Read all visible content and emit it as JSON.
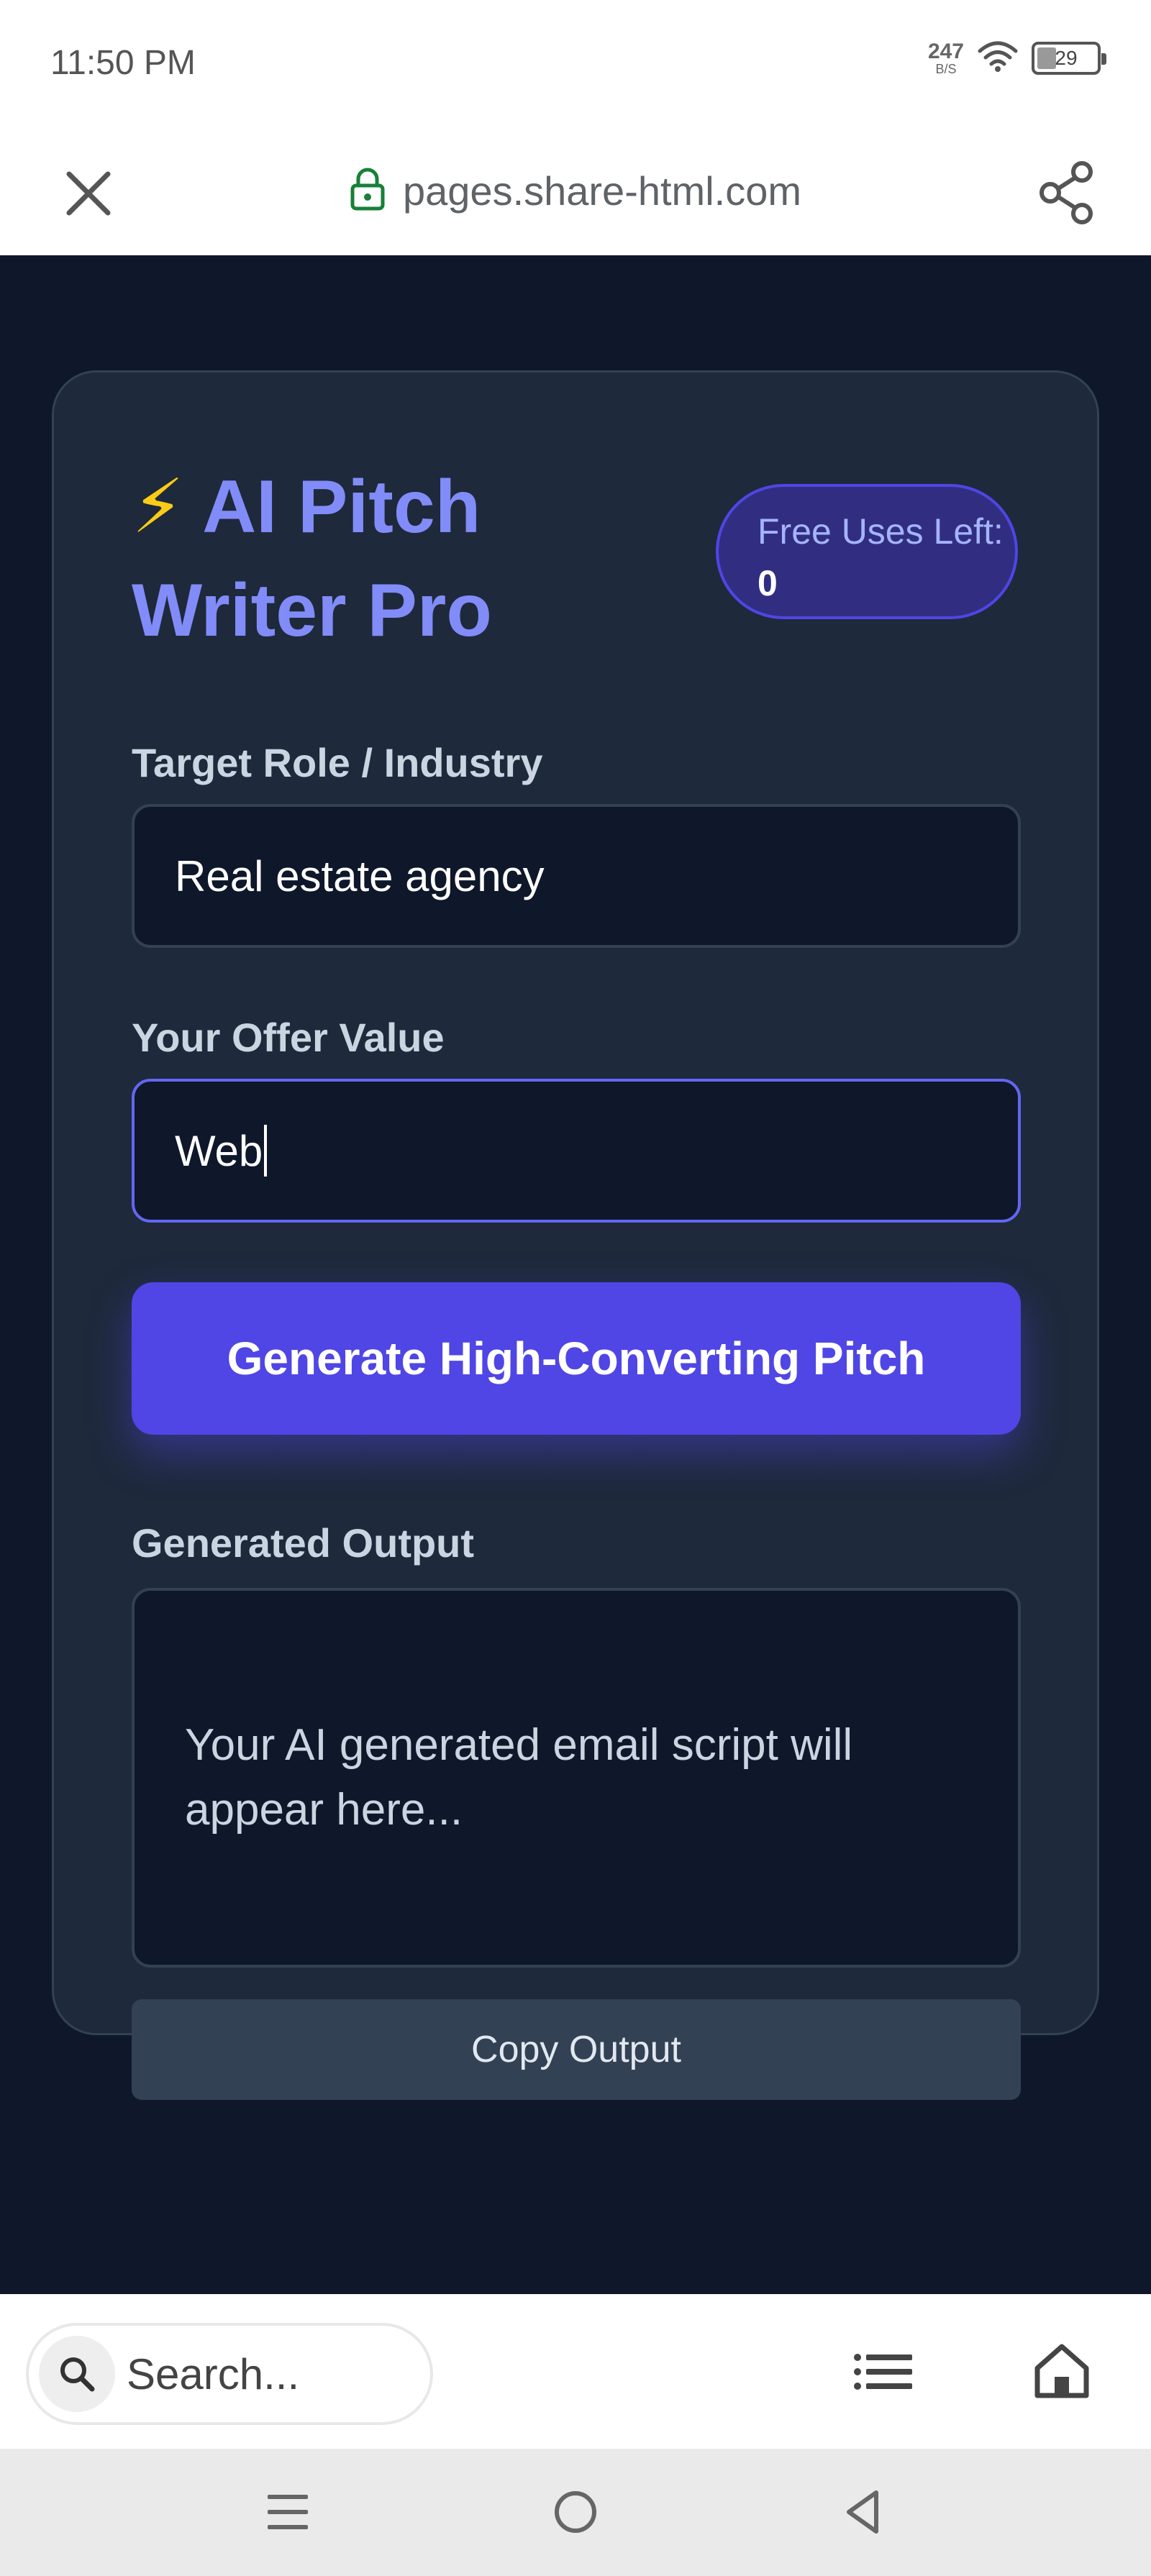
{
  "status_bar": {
    "time": "11:50 PM",
    "net_speed_value": "247",
    "net_speed_unit": "B/S",
    "battery_level": "29",
    "battery_fraction": 0.29
  },
  "browser": {
    "url": "pages.share-html.com",
    "close_icon": "close-icon",
    "lock_icon": "lock-icon",
    "share_icon": "share-icon"
  },
  "app": {
    "title_icon": "⚡",
    "title": "AI Pitch Writer Pro",
    "uses_label": "Free Uses Left:",
    "uses_count": "0",
    "target_label": "Target Role / Industry",
    "target_value": "Real estate agency",
    "offer_label": "Your Offer Value",
    "offer_value": "Web",
    "generate_label": "Generate High-Converting Pitch",
    "output_label": "Generated Output",
    "output_placeholder": "Your AI generated email script will appear here...",
    "copy_label": "Copy Output"
  },
  "bottom_toolbar": {
    "search_placeholder": "Search...",
    "search_icon": "search-icon",
    "tabs_icon": "tabs-list-icon",
    "home_icon": "home-icon"
  },
  "nav_bar": {
    "recents_icon": "recents-icon",
    "home_icon": "home-circle-icon",
    "back_icon": "back-icon"
  },
  "colors": {
    "page_bg": "#0f172a",
    "card_bg": "#1e293b",
    "accent": "#4f46e5",
    "title": "#818cf8"
  }
}
